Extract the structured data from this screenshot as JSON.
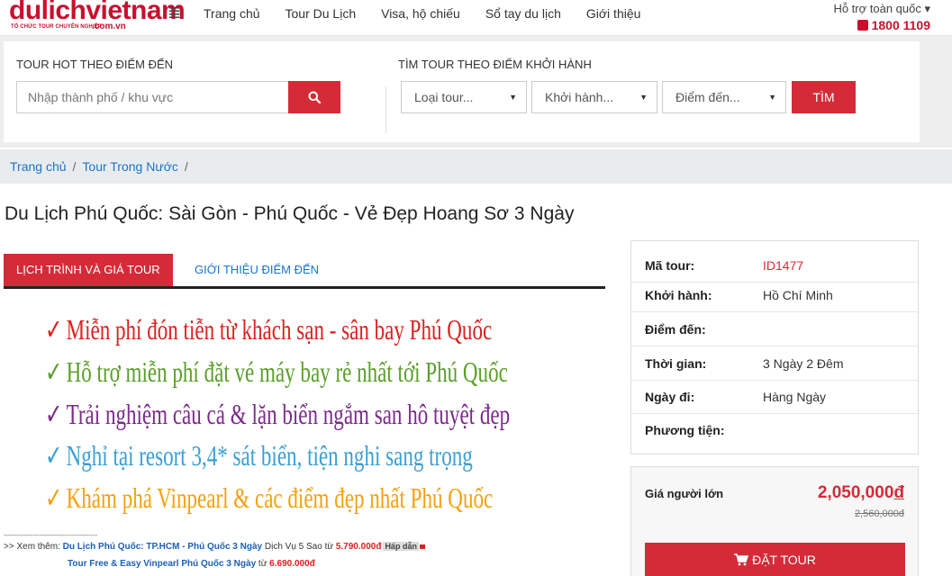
{
  "header": {
    "logo_text": "dulichvietnam",
    "logo_tagline": "TỔ CHỨC TOUR CHUYÊN NGHIỆP",
    "logo_domain": ".com.vn",
    "nav": [
      "Trang chủ",
      "Tour Du Lịch",
      "Visa, hộ chiếu",
      "Sổ tay du lịch",
      "Giới thiệu"
    ],
    "support_label": "Hỗ trợ toàn quốc ▾",
    "hotline": "1800 1109"
  },
  "search": {
    "hot_title": "TOUR HOT THEO ĐIỂM ĐẾN",
    "hot_placeholder": "Nhập thành phố / khu vực",
    "find_title": "TÌM TOUR THEO ĐIỂM KHỞI HÀNH",
    "selects": [
      "Loại tour...",
      "Khởi hành...",
      "Điểm đến..."
    ],
    "find_button": "TÌM"
  },
  "breadcrumb": [
    "Trang chủ",
    "Tour Trong Nước"
  ],
  "page_title": "Du Lịch Phú Quốc: Sài Gòn - Phú Quốc - Vẻ Đẹp Hoang Sơ 3 Ngày",
  "tabs": [
    "LỊCH TRÌNH VÀ GIÁ TOUR",
    "GIỚI THIỆU ĐIỂM ĐẾN"
  ],
  "promo_lines": [
    "Miễn phí đón tiễn từ khách sạn - sân bay Phú Quốc",
    "Hỗ trợ miễn phí đặt vé máy bay rẻ nhất tới Phú Quốc",
    "Trải nghiệm câu cá & lặn biển ngắm san hô tuyệt đẹp",
    "Nghỉ tại resort 3,4* sát biển, tiện nghi sang trọng",
    "Khám phá Vinpearl & các điểm đẹp nhất Phú Quốc"
  ],
  "promo_tick": "✓",
  "see_more": {
    "dashes": "------------------------------------------------",
    "prefix": ">> Xem thêm: ",
    "line1_link": "Du Lịch Phú Quốc: TP.HCM - Phú Quốc 3 Ngày",
    "line1_text": " Dịch Vụ 5 Sao từ ",
    "line1_price": "5.790.000đ",
    "line1_badge": "Hấp dẫn",
    "line2_link": "Tour Free & Easy Vinpearl Phú Quốc 3 Ngày",
    "line2_text": " từ ",
    "line2_price": "6.690.000đ"
  },
  "tour_info": [
    {
      "label": "Mã tour:",
      "value": "ID1477"
    },
    {
      "label": "Khởi hành:",
      "value": "Hồ Chí Minh"
    },
    {
      "label": "Điểm đến:",
      "value": ""
    },
    {
      "label": "Thời gian:",
      "value": "3 Ngày 2 Đêm"
    },
    {
      "label": "Ngày đi:",
      "value": "Hàng Ngày"
    },
    {
      "label": "Phương tiện:",
      "value": ""
    }
  ],
  "price": {
    "label": "Giá người lớn",
    "current": "2,050,000",
    "currency": "đ",
    "old": "2,560,000đ",
    "book_button": "ĐẶT TOUR"
  },
  "colors": {
    "brand_red": "#d52b38",
    "link_blue": "#1a73c9"
  }
}
